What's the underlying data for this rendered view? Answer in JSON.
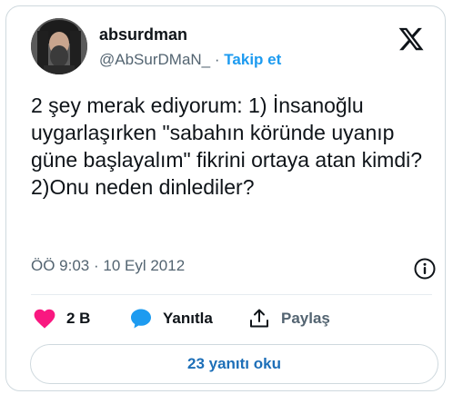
{
  "author": {
    "name": "absurdman",
    "handle": "@AbSurDMaN_",
    "separator": "·",
    "follow_label": "Takip et"
  },
  "tweet": {
    "text": "2 şey merak ediyorum: 1) İnsanoğlu uygarlaşırken \"sabahın köründe uyanıp güne başlayalım\" fikrini ortaya atan kimdi? 2)Onu neden dinlediler?",
    "timestamp": "ÖÖ 9:03 · 10 Eyl 2012"
  },
  "actions": {
    "like_count": "2 B",
    "reply_label": "Yanıtla",
    "share_label": "Paylaş"
  },
  "read_replies_label": "23 yanıtı oku",
  "colors": {
    "accent": "#1d9bf0",
    "like": "#f91880",
    "text": "#0f1419",
    "muted": "#536471"
  },
  "icons": [
    "x-logo-icon",
    "info-icon",
    "heart-icon",
    "reply-bubble-icon",
    "share-icon"
  ]
}
